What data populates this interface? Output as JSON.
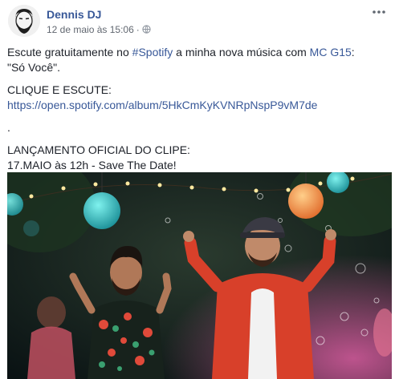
{
  "post": {
    "author": "Dennis DJ",
    "timestamp": "12 de maio às 15:06",
    "separator": "·",
    "privacy_icon": "globe-icon",
    "more_icon": "more-options-icon",
    "text": {
      "line1_prefix": "Escute gratuitamente no ",
      "line1_hashtag": "#Spotify",
      "line1_middle": " a minha nova música com ",
      "line1_mention": "MC G15",
      "line1_suffix": ":",
      "line2": "\"Só Você\".",
      "cta": "CLIQUE E ESCUTE:",
      "url": "https://open.spotify.com/album/5HkCmKyKVNRpNspP9vM7de",
      "dot": ".",
      "announcement": "LANÇAMENTO OFICIAL DO CLIPE:",
      "date_line": "17.MAIO às 12h - Save The Date!"
    },
    "photo_icon": "photo-two-performers-party-lanterns"
  },
  "colors": {
    "link": "#385898",
    "text": "#1d2129",
    "meta": "#616770"
  }
}
